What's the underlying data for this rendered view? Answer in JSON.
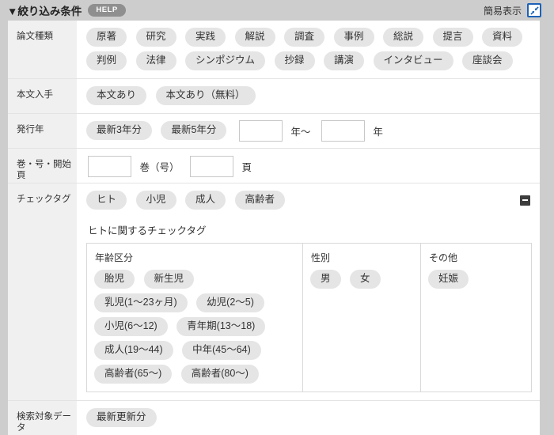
{
  "colors": {
    "accent_blue": "#1c62b7",
    "pill_gray": "#e5e5e5",
    "label_column_gray": "#f0f0f0",
    "page_background": "#cdcdcd",
    "help_badge_gray": "#8f8f8f",
    "minus_button_dark": "#3d3d3d"
  },
  "icons": {
    "section_toggle": "triangle-down-icon",
    "simple_view": "shrink-arrows-icon",
    "checktag_collapse": "minus-icon"
  },
  "header": {
    "title": "▼絞り込み条件",
    "help_label": "HELP",
    "simple_view_label": "簡易表示"
  },
  "filters": {
    "article_type": {
      "label": "論文種類",
      "pills": [
        "原著",
        "研究",
        "実践",
        "解説",
        "調査",
        "事例",
        "総説",
        "提言",
        "資料",
        "判例",
        "法律",
        "シンポジウム",
        "抄録",
        "講演",
        "インタビュー",
        "座談会"
      ]
    },
    "fulltext": {
      "label": "本文入手",
      "pills": [
        "本文あり",
        "本文あり（無料）"
      ]
    },
    "pub_year": {
      "label": "発行年",
      "pills": [
        "最新3年分",
        "最新5年分"
      ],
      "from_value": "",
      "from_suffix": "年～",
      "to_value": "",
      "to_suffix": "年"
    },
    "volume": {
      "label": "巻・号・開始頁",
      "volume_value": "",
      "volume_suffix": "巻（号）",
      "page_value": "",
      "page_suffix": "頁"
    },
    "checktag": {
      "label": "チェックタグ",
      "pills": [
        "ヒト",
        "小児",
        "成人",
        "高齢者"
      ],
      "subsection": {
        "title": "ヒトに関するチェックタグ",
        "columns": [
          {
            "heading": "年齢区分",
            "pills": [
              "胎児",
              "新生児",
              "乳児(1～23ヶ月)",
              "幼児(2～5)",
              "小児(6～12)",
              "青年期(13～18)",
              "成人(19～44)",
              "中年(45～64)",
              "高齢者(65～)",
              "高齢者(80～)"
            ]
          },
          {
            "heading": "性別",
            "pills": [
              "男",
              "女"
            ]
          },
          {
            "heading": "その他",
            "pills": [
              "妊娠"
            ]
          }
        ]
      }
    },
    "search_target": {
      "label": "検索対象データ",
      "pills": [
        "最新更新分"
      ]
    }
  }
}
